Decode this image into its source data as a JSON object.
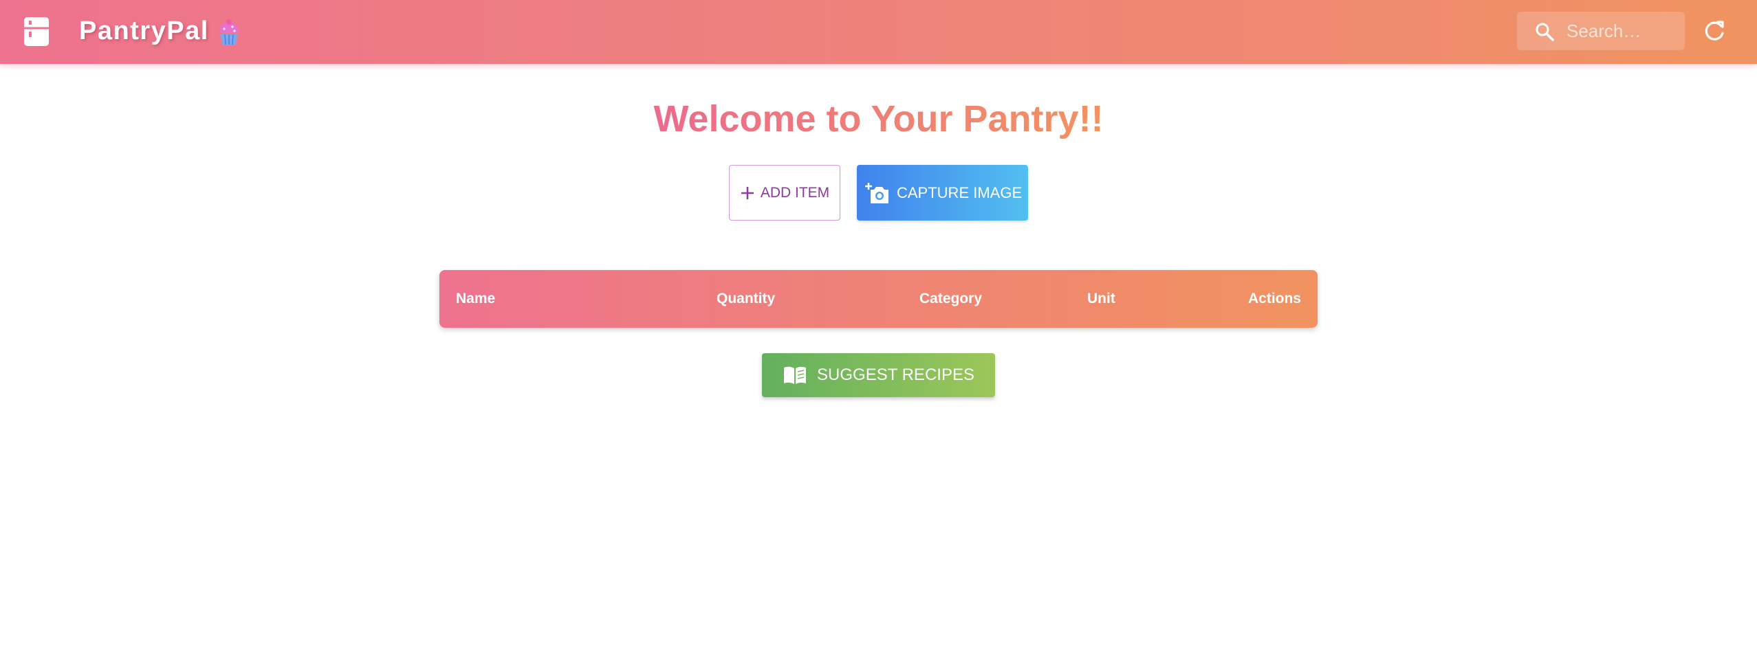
{
  "app": {
    "title": "PantryPal",
    "colors": {
      "primary_pink": "#ee738f",
      "primary_orange": "#f19360",
      "add_button_text": "#8e3a9e",
      "capture_button_start": "#3f82ec",
      "capture_button_end": "#53bff0",
      "suggest_button_start": "#63b05d",
      "suggest_button_end": "#9cc75a"
    },
    "icons": {
      "logo": "fridge-icon",
      "title_decoration": "cupcake-icon",
      "search": "search-icon",
      "refresh": "refresh-icon"
    }
  },
  "search": {
    "placeholder": "Search…",
    "value": ""
  },
  "main": {
    "welcome": "Welcome to Your Pantry!!",
    "add_item_label": "ADD ITEM",
    "capture_image_label": "CAPTURE IMAGE",
    "suggest_recipes_label": "SUGGEST RECIPES"
  },
  "table": {
    "columns": [
      "Name",
      "Quantity",
      "Category",
      "Unit",
      "Actions"
    ],
    "rows": []
  }
}
